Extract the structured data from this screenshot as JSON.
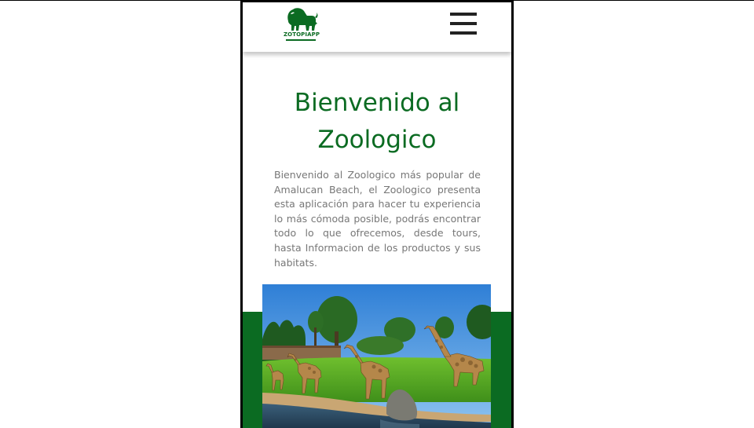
{
  "header": {
    "logo_text": "ZOTOPIAPP",
    "logo_icon": "lion-icon",
    "menu_icon": "hamburger-menu-icon"
  },
  "main": {
    "title_line1": "Bienvenido al",
    "title_line2": "Zoologico",
    "intro": "Bienvenido al Zoologico más popular de Amalucan Beach, el Zoologico presenta esta aplicación para hacer tu experiencia lo más cómoda posible, podrás encontrar todo lo que ofrecemos, desde tours, hasta Informacion de los productos y sus habitats."
  },
  "colors": {
    "brand_green": "#0b6b22",
    "text_gray": "#777777"
  }
}
